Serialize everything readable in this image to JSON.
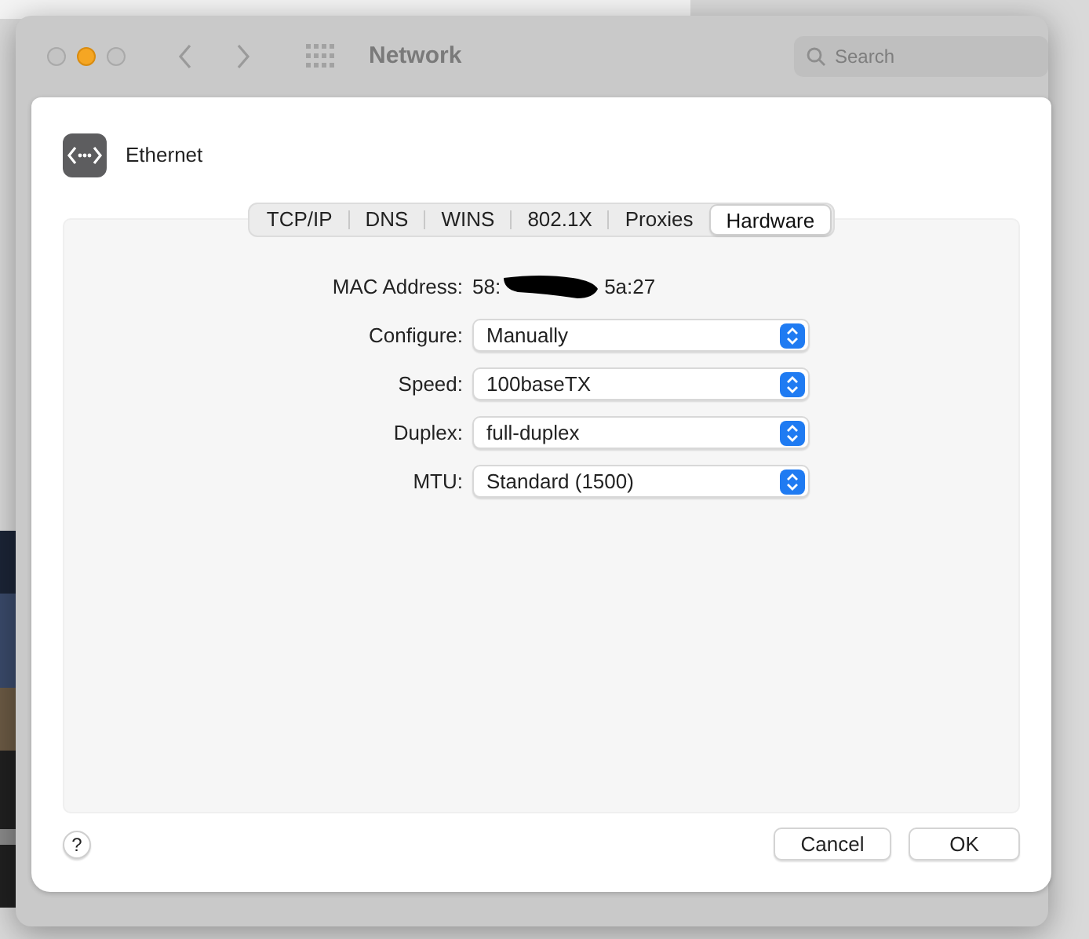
{
  "window": {
    "title": "Network",
    "search": {
      "placeholder": "Search"
    }
  },
  "sheet": {
    "service": "Ethernet",
    "tabs": [
      {
        "label": "TCP/IP",
        "selected": false
      },
      {
        "label": "DNS",
        "selected": false
      },
      {
        "label": "WINS",
        "selected": false
      },
      {
        "label": "802.1X",
        "selected": false
      },
      {
        "label": "Proxies",
        "selected": false
      },
      {
        "label": "Hardware",
        "selected": true
      }
    ],
    "mac_address": {
      "label": "MAC Address:",
      "value_start": "58:",
      "value_end": "5a:27",
      "redacted": true
    },
    "fields": [
      {
        "label": "Configure:",
        "value": "Manually"
      },
      {
        "label": "Speed:",
        "value": "100baseTX"
      },
      {
        "label": "Duplex:",
        "value": "full-duplex"
      },
      {
        "label": "MTU:",
        "value": "Standard (1500)"
      }
    ],
    "help": "?",
    "buttons": [
      "Cancel",
      "OK"
    ]
  }
}
